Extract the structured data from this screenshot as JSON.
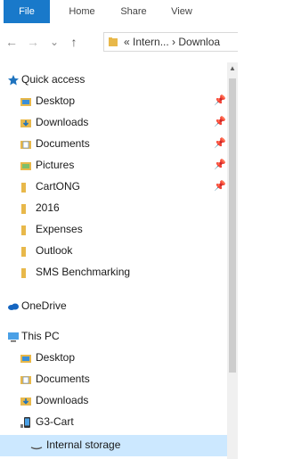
{
  "ribbon": {
    "tabs": [
      "File",
      "Home",
      "Share",
      "View"
    ]
  },
  "address_bar": {
    "back_glyph": "←",
    "forward_glyph": "→",
    "recent_glyph": "⌄",
    "up_glyph": "↑",
    "path_text": "« Intern... › Downloa"
  },
  "navigation_pane": {
    "quick_access": {
      "label": "Quick access",
      "items": [
        {
          "label": "Desktop",
          "icon": "desktop-folder-icon",
          "pinned": true
        },
        {
          "label": "Downloads",
          "icon": "downloads-folder-icon",
          "pinned": true
        },
        {
          "label": "Documents",
          "icon": "documents-folder-icon",
          "pinned": true
        },
        {
          "label": "Pictures",
          "icon": "pictures-folder-icon",
          "pinned": true
        },
        {
          "label": "CartONG",
          "icon": "folder-icon",
          "pinned": true
        },
        {
          "label": "2016",
          "icon": "folder-icon",
          "pinned": false
        },
        {
          "label": "Expenses",
          "icon": "folder-icon",
          "pinned": false
        },
        {
          "label": "Outlook",
          "icon": "folder-icon",
          "pinned": false
        },
        {
          "label": "SMS Benchmarking",
          "icon": "folder-icon",
          "pinned": false
        }
      ]
    },
    "onedrive": {
      "label": "OneDrive"
    },
    "this_pc": {
      "label": "This PC",
      "items": [
        {
          "label": "Desktop",
          "icon": "desktop-folder-icon"
        },
        {
          "label": "Documents",
          "icon": "documents-folder-icon"
        },
        {
          "label": "Downloads",
          "icon": "downloads-folder-icon"
        },
        {
          "label": "G3-Cart",
          "icon": "phone-icon"
        },
        {
          "label": "Internal storage",
          "icon": "storage-icon",
          "selected": true
        }
      ]
    }
  },
  "colors": {
    "file_tab_bg": "#1979ca",
    "folder_yellow": "#e8b84a",
    "selection_bg": "#cce8ff",
    "quick_access_star": "#1e73be",
    "onedrive_blue": "#1565c0"
  }
}
